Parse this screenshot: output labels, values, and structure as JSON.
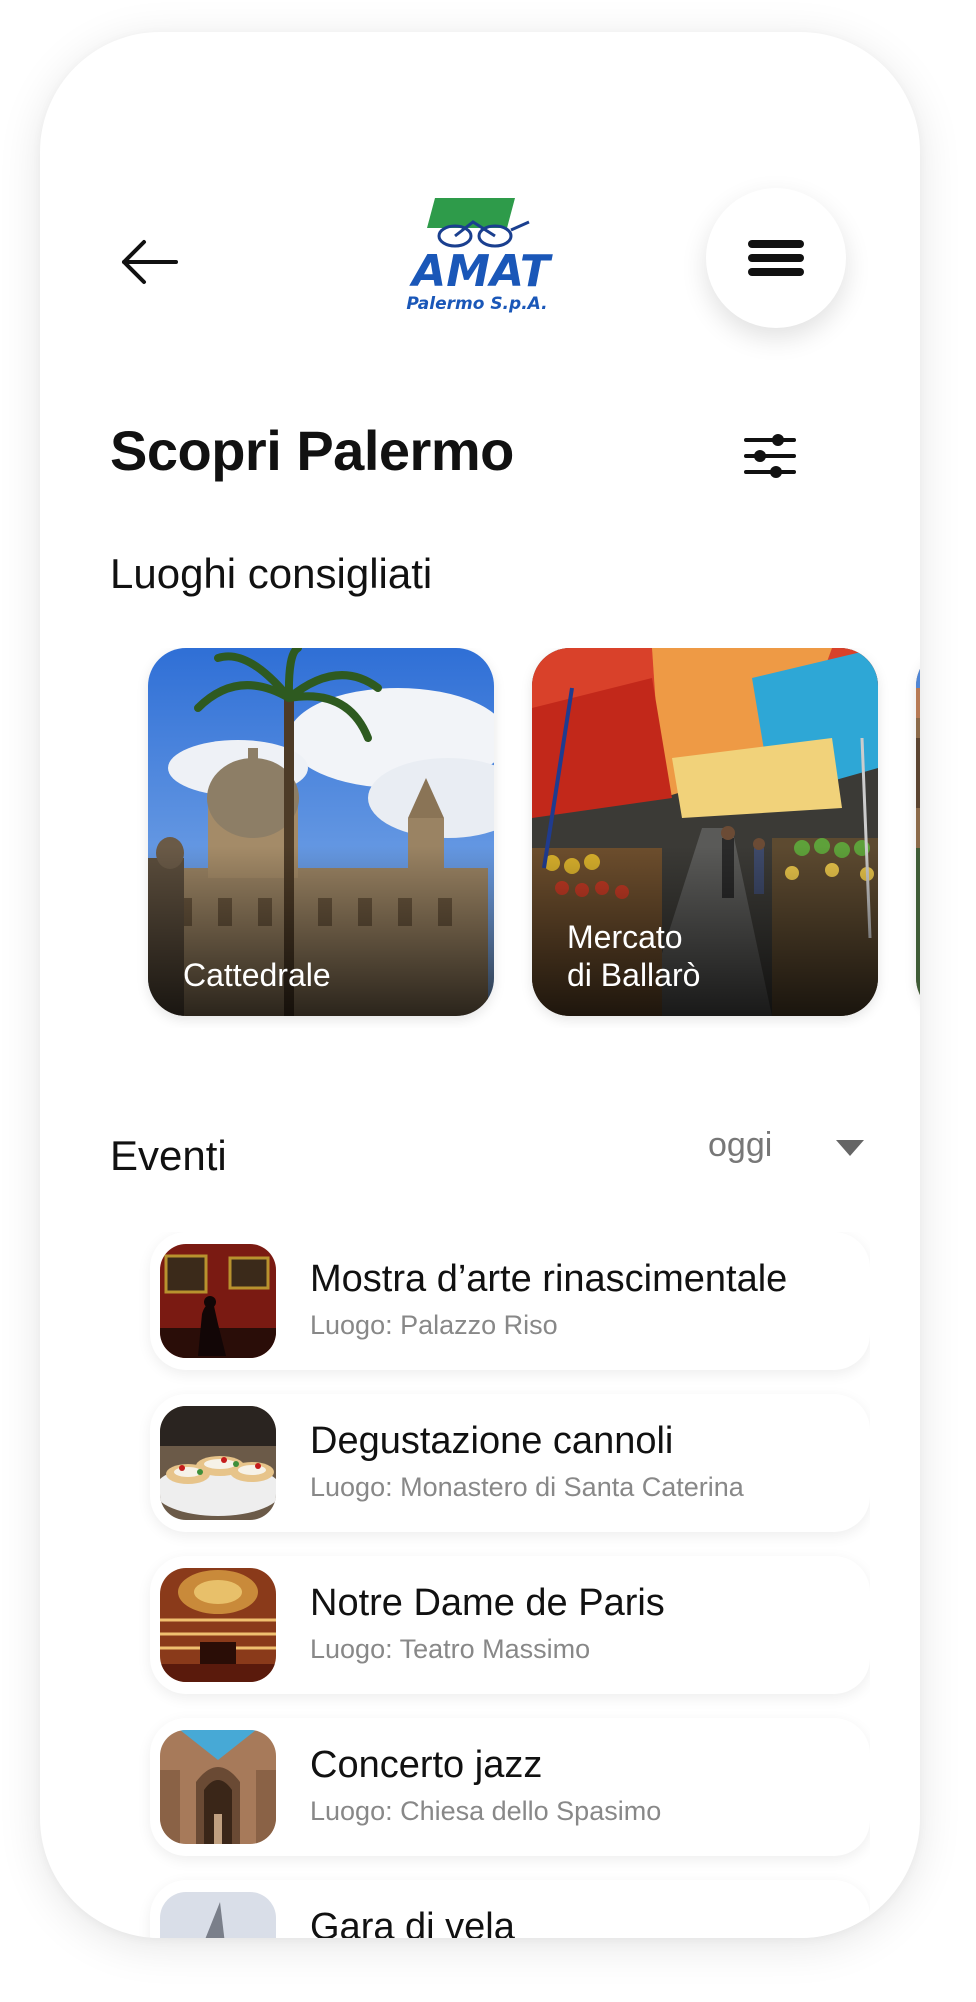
{
  "header": {
    "back_icon": "arrow-left-icon",
    "logo": {
      "brand": "AMAT",
      "tagline": "Palermo S.p.A."
    },
    "menu_icon": "hamburger-menu-icon"
  },
  "page": {
    "title": "Scopri Palermo",
    "filter_icon": "sliders-icon"
  },
  "places": {
    "section_title": "Luoghi consigliati",
    "items": [
      {
        "label": "Cattedrale"
      },
      {
        "label": "Mercato\ndi Ballarò"
      },
      {
        "label": ""
      }
    ]
  },
  "events": {
    "section_title": "Eventi",
    "date_filter": "oggi",
    "items": [
      {
        "title": "Mostra d’arte rinascimentale",
        "place": "Luogo: Palazzo Riso"
      },
      {
        "title": "Degustazione cannoli",
        "place": "Luogo: Monastero di Santa Caterina"
      },
      {
        "title": "Notre Dame de Paris",
        "place": "Luogo: Teatro Massimo"
      },
      {
        "title": "Concerto jazz",
        "place": "Luogo: Chiesa dello Spasimo"
      },
      {
        "title": "Gara di vela",
        "place": ""
      }
    ]
  },
  "colors": {
    "text": "#111111",
    "muted": "#888888",
    "logo_green": "#2e9b4a",
    "logo_blue": "#1a57b8"
  }
}
